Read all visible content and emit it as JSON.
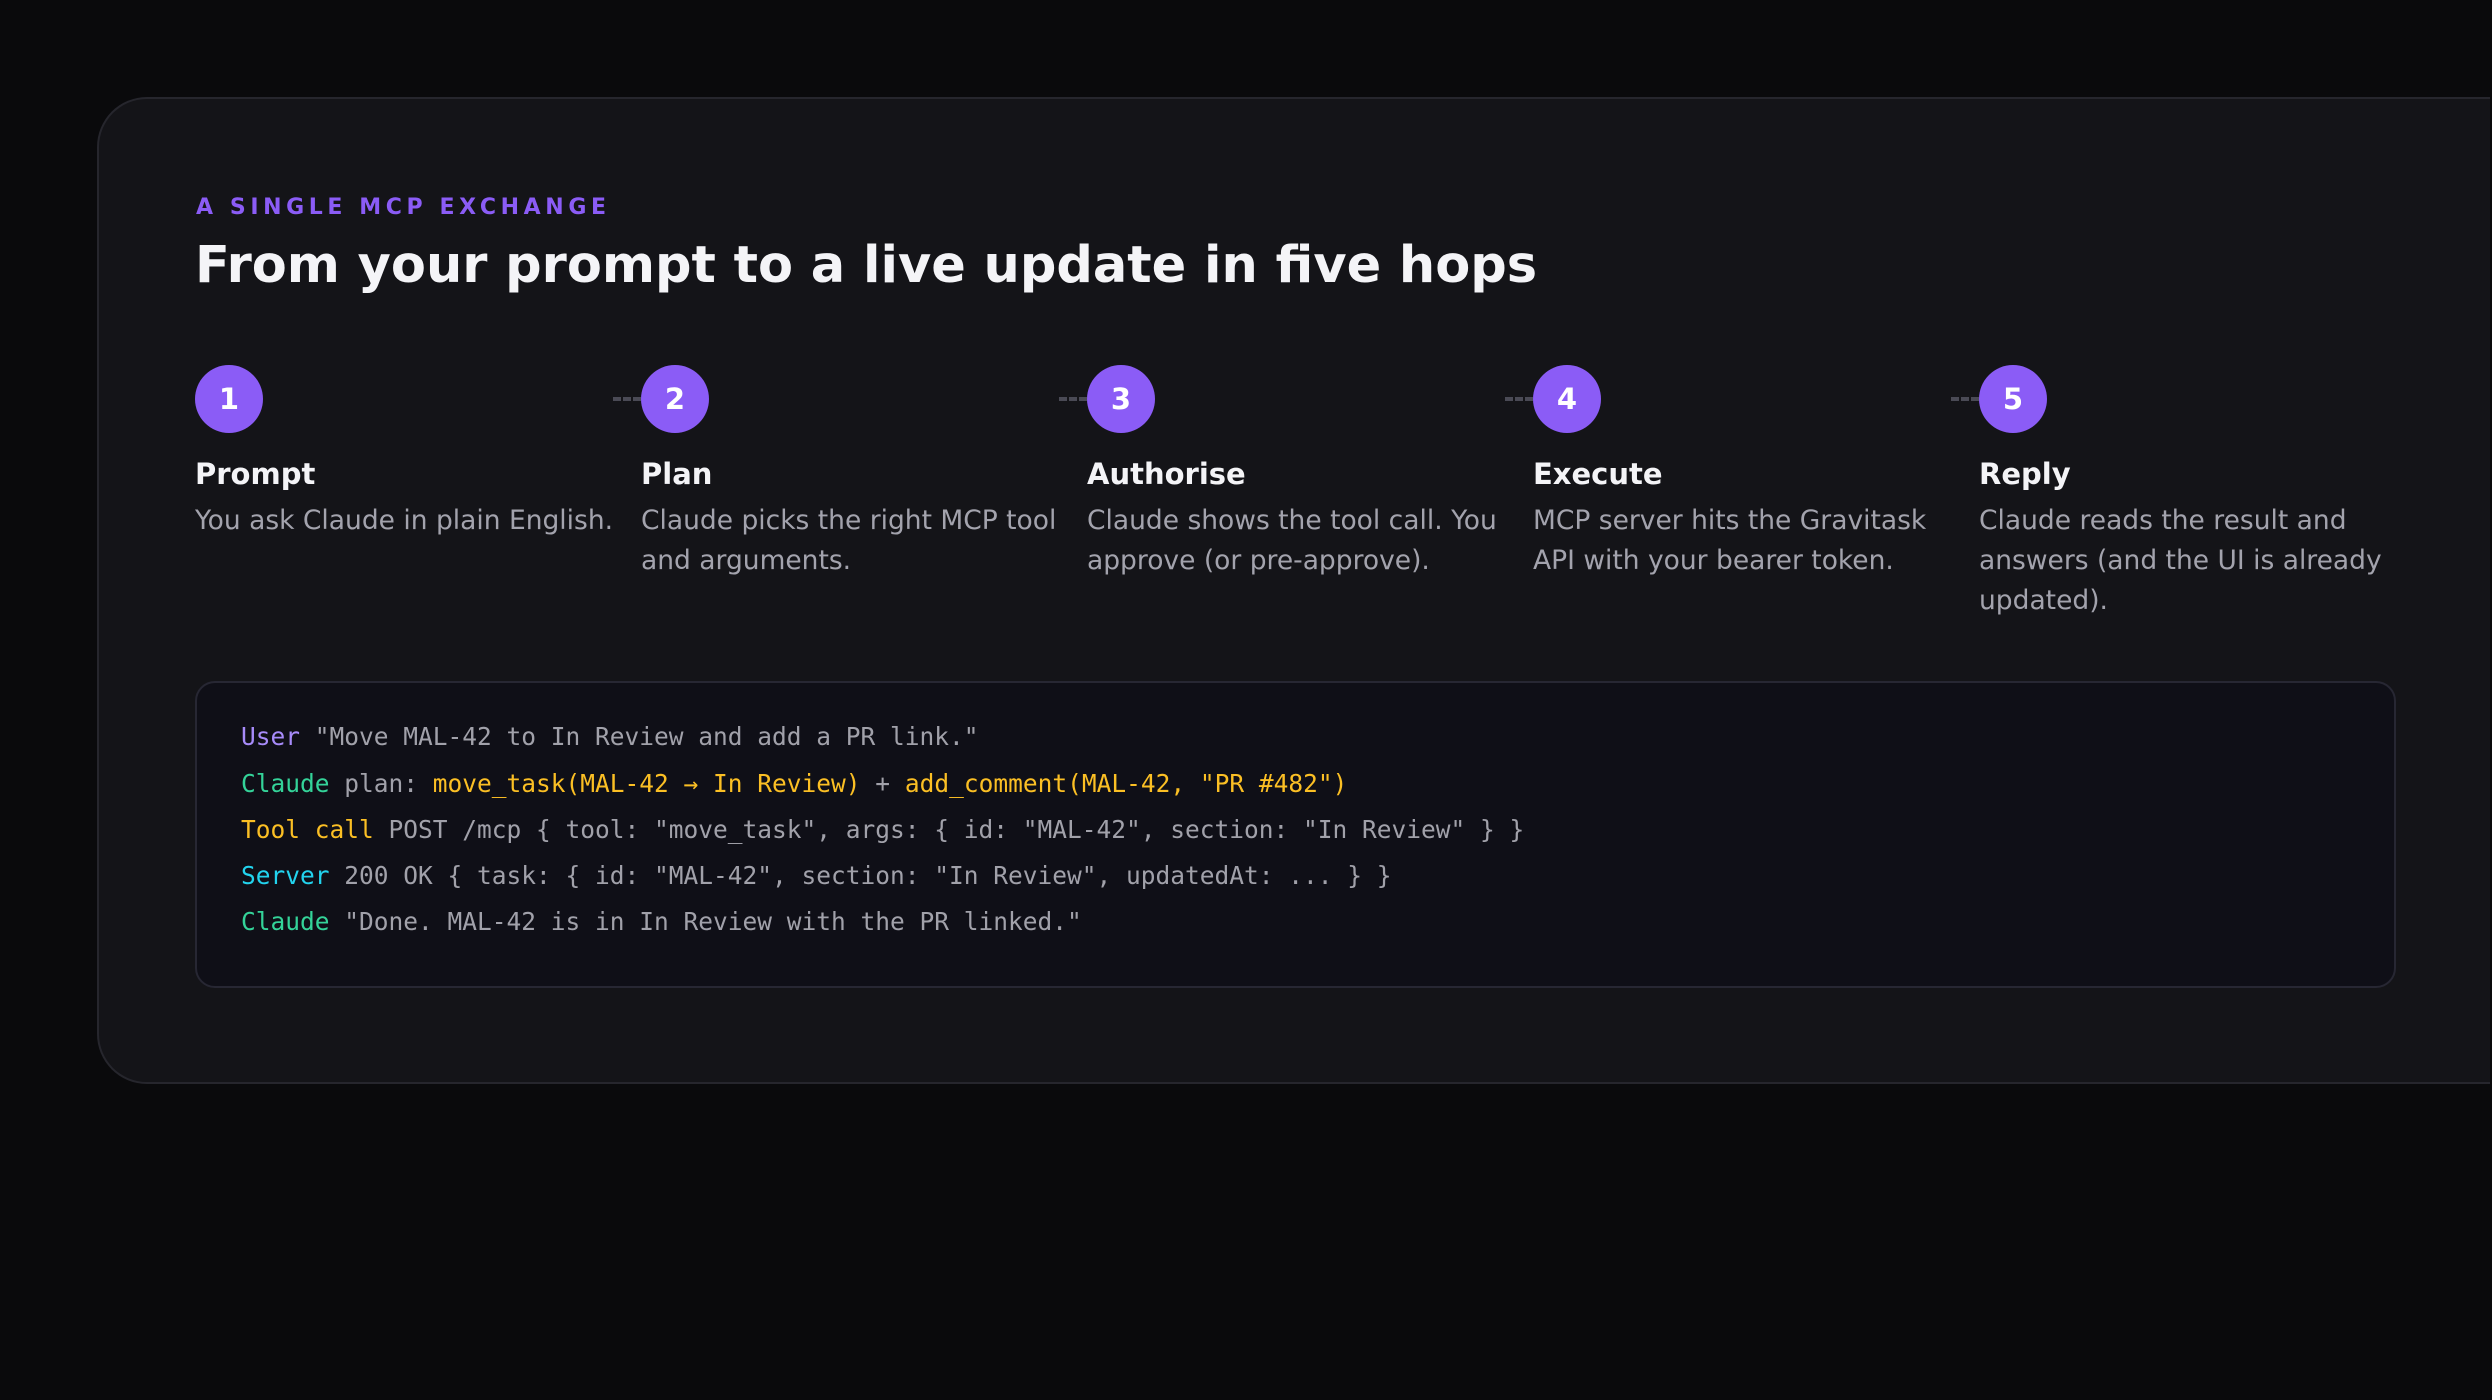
{
  "header": {
    "eyebrow": "A SINGLE MCP EXCHANGE",
    "title": "From your prompt to a live update in five hops"
  },
  "steps": [
    {
      "number": "1",
      "title": "Prompt",
      "description": "You ask Claude in plain English."
    },
    {
      "number": "2",
      "title": "Plan",
      "description": "Claude picks the right MCP tool and arguments."
    },
    {
      "number": "3",
      "title": "Authorise",
      "description": "Claude shows the tool call. You approve (or pre-approve)."
    },
    {
      "number": "4",
      "title": "Execute",
      "description": "MCP server hits the Gravitask API with your bearer token."
    },
    {
      "number": "5",
      "title": "Reply",
      "description": "Claude reads the result and answers (and the UI is already updated)."
    }
  ],
  "transcript": [
    {
      "role": "User",
      "parts": [
        {
          "text": " \"Move MAL-42 to In Review and add a PR link.\""
        }
      ]
    },
    {
      "role": "Claude",
      "parts": [
        {
          "text": " plan: "
        },
        {
          "text": "move_task(MAL-42 → In Review)",
          "highlight": true
        },
        {
          "text": " + "
        },
        {
          "text": "add_comment(MAL-42, \"PR #482\")",
          "highlight": true
        }
      ]
    },
    {
      "role": "Tool call",
      "parts": [
        {
          "text": " POST /mcp { tool: \"move_task\", args: { id: \"MAL-42\", section: \"In Review\" } }"
        }
      ]
    },
    {
      "role": "Server",
      "parts": [
        {
          "text": " 200 OK { task: { id: \"MAL-42\", section: \"In Review\", updatedAt: ... } }"
        }
      ]
    },
    {
      "role": "Claude",
      "parts": [
        {
          "text": " \"Done. MAL-42 is in In Review with the PR linked.\""
        }
      ]
    }
  ],
  "colors": {
    "accent": "#8b5cf6",
    "background": "#0a0a0c",
    "card": "#141418",
    "role_user": "#a78bfa",
    "role_claude": "#34d399",
    "role_tool_call": "#fbbf24",
    "role_server": "#22d3ee",
    "highlight": "#fbbf24",
    "code_text": "#a1a1aa"
  }
}
